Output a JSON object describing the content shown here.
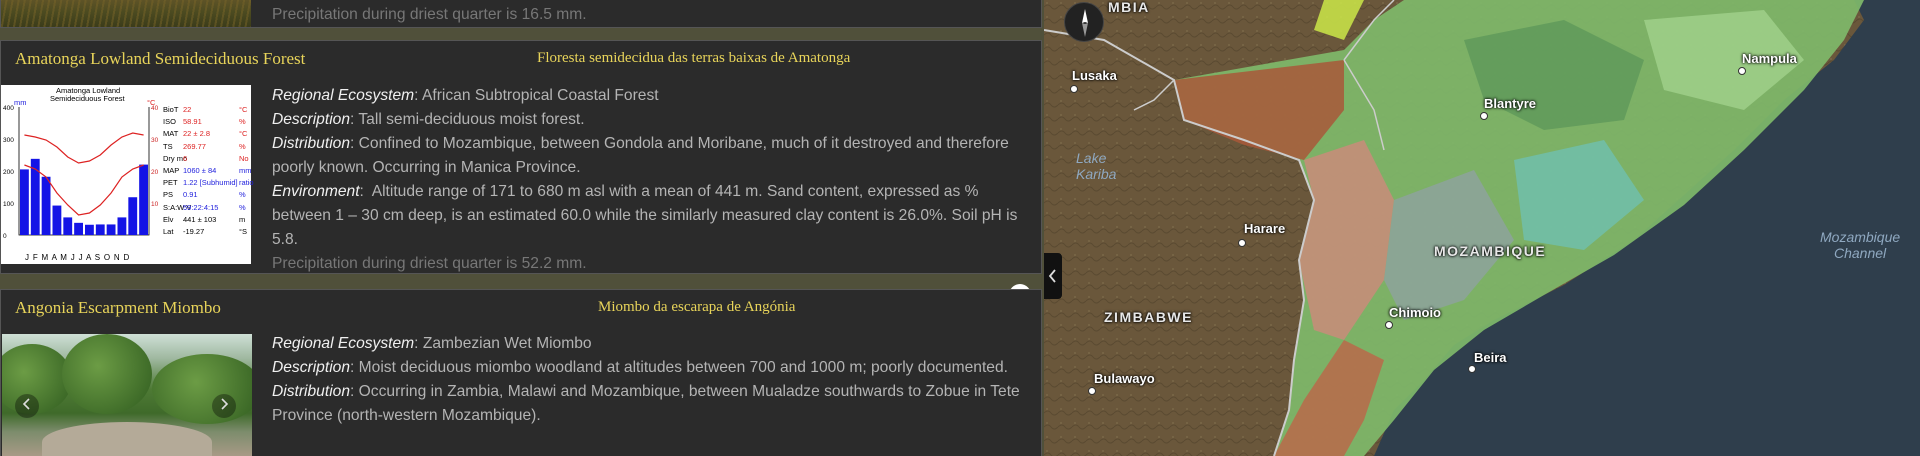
{
  "previous_card": {
    "text_faded": "Precipitation during driest quarter is 16.5 mm."
  },
  "card1": {
    "title_en": "Amatonga Lowland Semideciduous Forest",
    "title_pt": "Floresta semidecidua das terras baixas de Amatonga",
    "regional_ecosystem_label": "Regional Ecosystem",
    "regional_ecosystem": "African Subtropical Coastal Forest",
    "description_label": "Description",
    "description": "Tall semi-deciduous moist forest.",
    "distribution_label": "Distribution",
    "distribution": "Confined to Mozambique, between Gondola and Moribane, much of it destroyed and therefore poorly known. Occurring in Manica Province.",
    "environment_label": "Environment",
    "environment": "Altitude range of 171 to 680 m asl with a mean of 441 m. Sand content, expressed as % between 1 – 30 cm deep, is an estimated 60.0 while the similarly measured clay content is 26.0%. Soil pH is 5.8.",
    "text_faded": "Precipitation during driest quarter is 52.2 mm.",
    "climate_chart": {
      "title_line1": "Amatonga Lowland",
      "title_line2": "Semideciduous Forest",
      "left_unit": "mm",
      "right_unit": "°C",
      "y_ticks_left": [
        "400",
        "300",
        "200",
        "100",
        "0"
      ],
      "y_ticks_right": [
        "40",
        "30",
        "20",
        "10"
      ],
      "months": "J F M A M J J A S O N D",
      "monthly_precip": [
        205,
        238,
        182,
        92,
        55,
        38,
        32,
        33,
        33,
        55,
        118,
        220
      ],
      "stats": [
        {
          "k": "BioT",
          "v": "22",
          "u": "°C"
        },
        {
          "k": "ISO",
          "v": "58.91",
          "u": "%"
        },
        {
          "k": "MAT",
          "v": "22   ±   2.8",
          "u": "°C"
        },
        {
          "k": "TS",
          "v": "269.77",
          "u": "%"
        },
        {
          "k": "Dry mo",
          "v": "6",
          "u": "No"
        },
        {
          "k": "MAP",
          "v": "1060  ±   84",
          "u": "mm"
        },
        {
          "k": "PET",
          "v": "1.22  [Subhumid]",
          "u": "ratio"
        },
        {
          "k": "PS",
          "v": "0.91",
          "u": "%"
        },
        {
          "k": "S:A:W:V",
          "v": "59:22:4:15",
          "u": "%"
        },
        {
          "k": "Elv",
          "v": "441   ±   103",
          "u": "m"
        },
        {
          "k": "Lat",
          "v": "-19.27",
          "u": "°S"
        }
      ]
    }
  },
  "card2": {
    "title_en": "Angonia Escarpment Miombo",
    "title_pt": "Miombo da escarapa de Angónia",
    "regional_ecosystem_label": "Regional Ecosystem",
    "regional_ecosystem": "Zambezian Wet Miombo",
    "description_label": "Description",
    "description": "Moist deciduous miombo woodland at altitudes between 700 and 1000 m; poorly documented.",
    "distribution_label": "Distribution",
    "distribution": "Occurring in Zambia, Malawi and Mozambique, between Mualadze southwards to Zobue in Tete Province (north-western Mozambique)."
  },
  "map": {
    "labels": {
      "zambia": "MBIA",
      "zimbabwe": "ZIMBABWE",
      "mozambique": "MOZAMBIQUE",
      "lake_kariba": "Lake Kariba",
      "lake_kariba_line1": "Lake",
      "lake_kariba_line2": "Kariba",
      "channel_line1": "Mozambique",
      "channel_line2": "Channel"
    },
    "cities": {
      "lusaka": "Lusaka",
      "blantyre": "Blantyre",
      "nampula": "Nampula",
      "harare": "Harare",
      "chimoio": "Chimoio",
      "beira": "Beira",
      "bulawayo": "Bulawayo"
    },
    "colors": {
      "land": "#6e5a3e",
      "ocean": "#2b3a4a",
      "ecoregion_green": "#7fb86a",
      "ecoregion_brown": "#a8583a",
      "ecoregion_pink": "#c98c7a"
    }
  },
  "controls": {
    "collapse_icon": "chevron-left-icon",
    "expand_icon": "double-chevron-down-icon",
    "compass_icon": "compass-icon"
  }
}
